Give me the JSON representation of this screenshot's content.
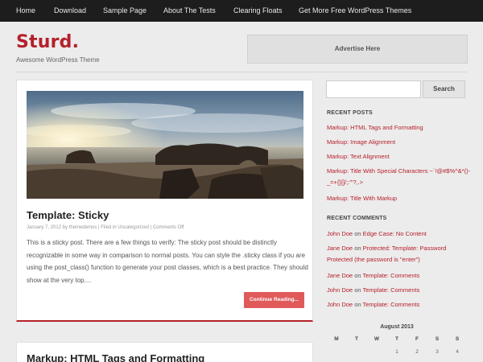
{
  "nav": {
    "items": [
      "Home",
      "Download",
      "Sample Page",
      "About The Tests",
      "Clearing Floats",
      "Get More Free WordPress Themes"
    ]
  },
  "site": {
    "title": "Sturd.",
    "tagline": "Awesome WordPress Theme"
  },
  "ad": {
    "label": "Advertise Here"
  },
  "posts": [
    {
      "title": "Template: Sticky",
      "meta": "January 7, 2012 by themedemos | Filed in Uncategorized | Comments Off",
      "excerpt": "This is a sticky post. There are a few things to verify: The sticky post should be distinctly recognizable in some way in comparison to normal posts. You can style the .sticky class if you are using the post_class() function to generate your post classes, which is a best practice. They should show at the very top....",
      "read_more": "Continue Reading..."
    },
    {
      "title": "Markup: HTML Tags and Formatting"
    }
  ],
  "sidebar": {
    "search": {
      "button_label": "Search",
      "placeholder": ""
    },
    "recent_posts": {
      "heading": "RECENT POSTS",
      "items": [
        "Markup: HTML Tags and Formatting",
        "Markup: Image Alignment",
        "Markup: Text Alignment",
        "Markup: Title With Special Characters ~`!@#$%^&*()-_=+{}[]/;:'\"?,.>",
        "Markup: Title With Markup"
      ]
    },
    "recent_comments": {
      "heading": "RECENT COMMENTS",
      "items": [
        {
          "author": "John Doe",
          "on": "on",
          "post": "Edge Case: No Content"
        },
        {
          "author": "Jane Doe",
          "on": "on",
          "post": "Protected: Template: Password Protected (the password is \"enter\")"
        },
        {
          "author": "Jane Doe",
          "on": "on",
          "post": "Template: Comments"
        },
        {
          "author": "John Doe",
          "on": "on",
          "post": "Template: Comments"
        },
        {
          "author": "John Doe",
          "on": "on",
          "post": "Template: Comments"
        }
      ]
    },
    "calendar": {
      "caption": "August 2013",
      "weekdays": [
        "M",
        "T",
        "W",
        "T",
        "F",
        "S",
        "S"
      ],
      "first_row": [
        "",
        "",
        "",
        "1",
        "2",
        "3",
        "4"
      ]
    }
  },
  "colors": {
    "accent": "#b5202b",
    "nav_bg": "#1d1d1d",
    "page_bg": "#ececec",
    "button": "#e05a5a"
  }
}
